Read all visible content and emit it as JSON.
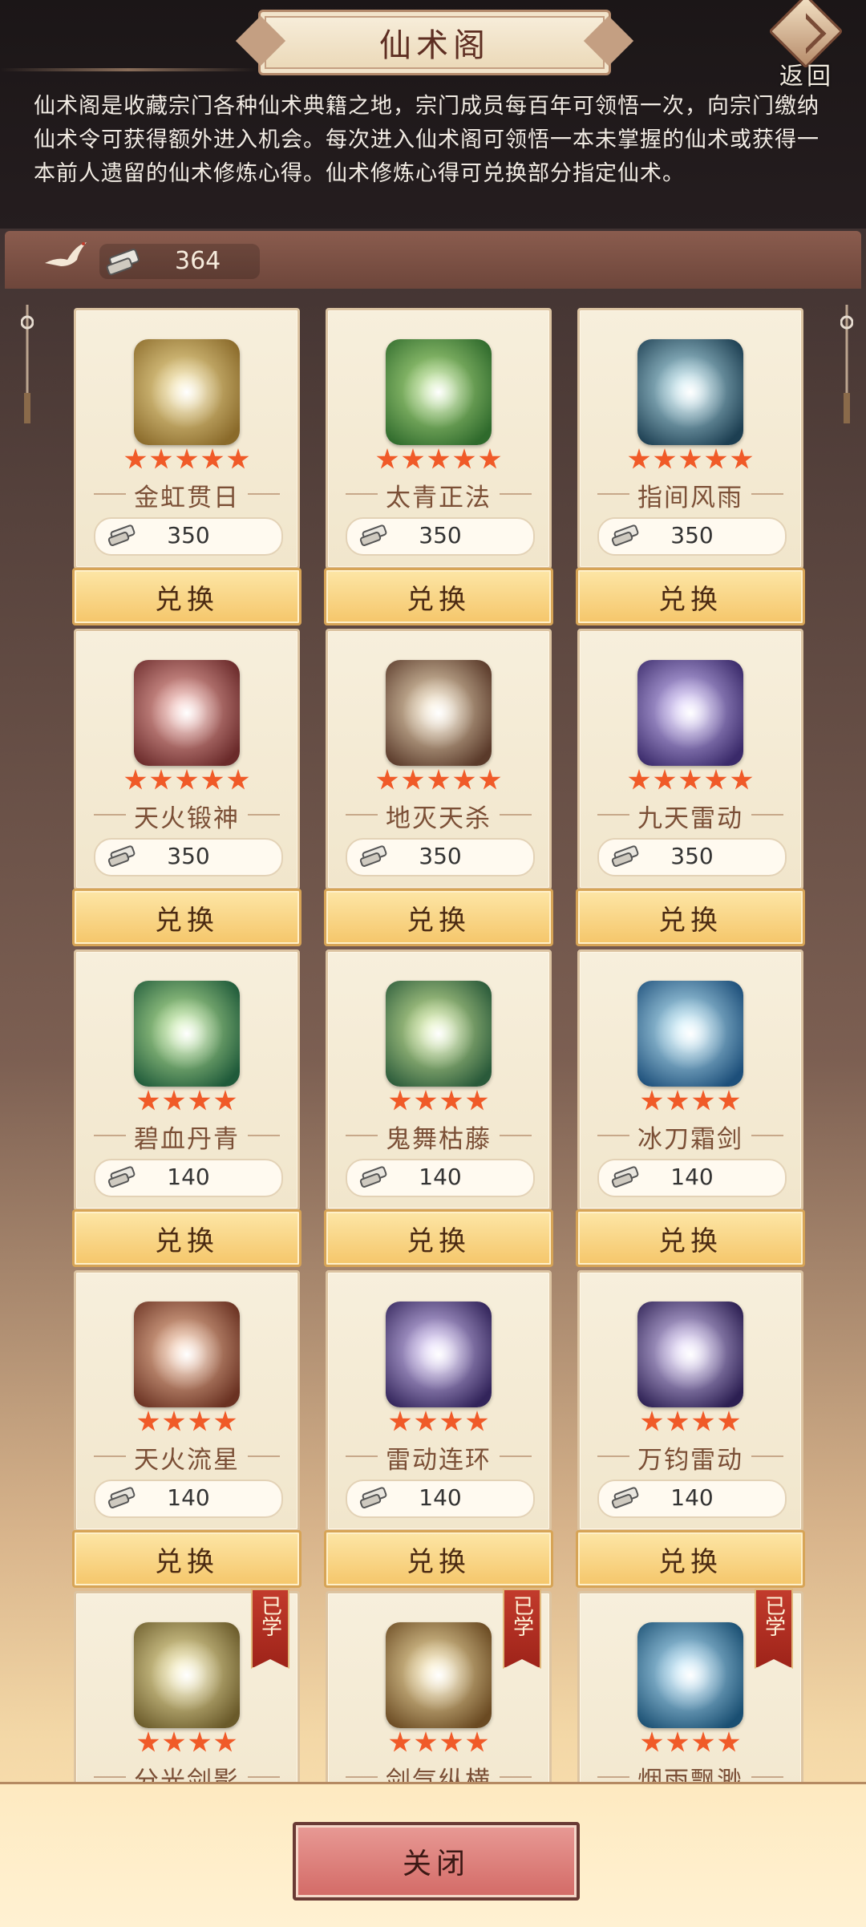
{
  "header": {
    "title": "仙术阁",
    "back_label": "返回",
    "intro": "仙术阁是收藏宗门各种仙术典籍之地，宗门成员每百年可领悟一次，向宗门缴纳仙术令可获得额外进入机会。每次进入仙术阁可领悟一本未掌握的仙术或获得一本前人遗留的仙术修炼心得。仙术修炼心得可兑换部分指定仙术。"
  },
  "currency": {
    "value": "364"
  },
  "exchange_label": "兑换",
  "learned_label": "已学",
  "close_label": "关闭",
  "skills": [
    {
      "name": "金虹贯日",
      "stars": 5,
      "price": "350",
      "colors": [
        "#f6e3a0",
        "#8a6a2a"
      ],
      "learned": false
    },
    {
      "name": "太青正法",
      "stars": 5,
      "price": "350",
      "colors": [
        "#b8e38a",
        "#2f6a2c"
      ],
      "learned": false
    },
    {
      "name": "指间风雨",
      "stars": 5,
      "price": "350",
      "colors": [
        "#bfe8f2",
        "#1d3f52"
      ],
      "learned": false
    },
    {
      "name": "天火锻神",
      "stars": 5,
      "price": "350",
      "colors": [
        "#f6b7b0",
        "#6a2a2a"
      ],
      "learned": false
    },
    {
      "name": "地灭天杀",
      "stars": 5,
      "price": "350",
      "colors": [
        "#f7e6c6",
        "#5a3a2a"
      ],
      "learned": false
    },
    {
      "name": "九天雷动",
      "stars": 5,
      "price": "350",
      "colors": [
        "#d8c8ff",
        "#3a2a6a"
      ],
      "learned": false
    },
    {
      "name": "碧血丹青",
      "stars": 4,
      "price": "140",
      "colors": [
        "#c7f0a0",
        "#1f5a3a"
      ],
      "learned": false
    },
    {
      "name": "鬼舞枯藤",
      "stars": 4,
      "price": "140",
      "colors": [
        "#d9f0a0",
        "#2a5a3a"
      ],
      "learned": false
    },
    {
      "name": "冰刀霜剑",
      "stars": 4,
      "price": "140",
      "colors": [
        "#c9f2ff",
        "#1d4f7a"
      ],
      "learned": false
    },
    {
      "name": "天火流星",
      "stars": 4,
      "price": "140",
      "colors": [
        "#f8c8a8",
        "#6a3222"
      ],
      "learned": false
    },
    {
      "name": "雷动连环",
      "stars": 4,
      "price": "140",
      "colors": [
        "#e0d0ff",
        "#32245a"
      ],
      "learned": false
    },
    {
      "name": "万钧雷动",
      "stars": 4,
      "price": "140",
      "colors": [
        "#e4d6ff",
        "#2c1f52"
      ],
      "learned": false
    },
    {
      "name": "分光剑影",
      "stars": 4,
      "price": "",
      "colors": [
        "#f8eeb0",
        "#6a5a2a"
      ],
      "learned": true
    },
    {
      "name": "剑气纵横",
      "stars": 4,
      "price": "",
      "colors": [
        "#fbe9b2",
        "#6a4a22"
      ],
      "learned": true
    },
    {
      "name": "烟雨飘渺",
      "stars": 4,
      "price": "",
      "colors": [
        "#bfeaff",
        "#1a4f72"
      ],
      "learned": true
    }
  ]
}
